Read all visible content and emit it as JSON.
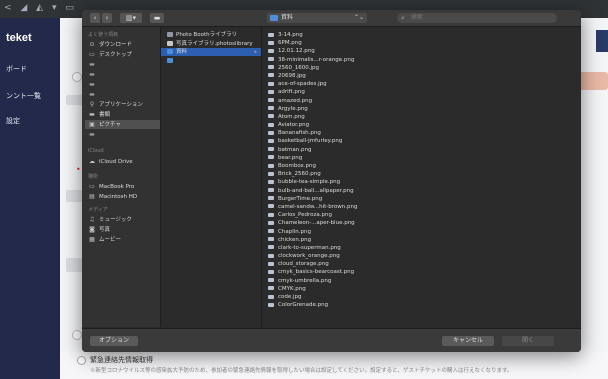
{
  "app": {
    "brand": "teket",
    "nav": [
      "ボード",
      "ンント一覧",
      "設定"
    ]
  },
  "background": {
    "emergency_title": "緊急連絡先情報取得",
    "emergency_desc": "※新型コロナウイルス等の感染拡大予防のため、参加者の緊急連絡先情報を取得したい場合は設定してください。設定すると、ゲストチケットの購入は行えなくなります。"
  },
  "dialog": {
    "toolbar": {
      "back": "‹",
      "forward": "›",
      "view": "▥▾",
      "path": "資料",
      "search_placeholder": "検索"
    },
    "sidebar": {
      "favorites_header": "よく使う項目",
      "favorites": [
        {
          "icon": "download-icon",
          "label": "ダウンロード"
        },
        {
          "icon": "desktop-icon",
          "label": "デスクトップ"
        },
        {
          "icon": "folder-icon",
          "label": ""
        },
        {
          "icon": "folder-icon",
          "label": ""
        },
        {
          "icon": "folder-icon",
          "label": ""
        },
        {
          "icon": "folder-icon",
          "label": ""
        },
        {
          "icon": "applications-icon",
          "label": "アプリケーション"
        },
        {
          "icon": "folder-icon",
          "label": "書類"
        },
        {
          "icon": "pictures-icon",
          "label": "ピクチャ"
        },
        {
          "icon": "folder-icon",
          "label": ""
        }
      ],
      "icloud_header": "iCloud",
      "icloud": [
        {
          "icon": "cloud-icon",
          "label": "iCloud Drive"
        }
      ],
      "locations_header": "場所",
      "locations": [
        {
          "icon": "laptop-icon",
          "label": "MacBook Pro"
        },
        {
          "icon": "disk-icon",
          "label": "Macintosh HD"
        }
      ],
      "media_header": "メディア",
      "media": [
        {
          "icon": "music-icon",
          "label": "ミュージック"
        },
        {
          "icon": "camera-icon",
          "label": "写真"
        },
        {
          "icon": "movie-icon",
          "label": "ムービー"
        }
      ]
    },
    "column1": [
      {
        "label": "Photo Boothライブラリ",
        "color": "#8e96a8",
        "selected": false,
        "chevron": false
      },
      {
        "label": "写真ライブラリ.photoslibrary",
        "color": "#c7c7c7",
        "selected": false,
        "chevron": false
      },
      {
        "label": "資料",
        "color": "#4e8ed8",
        "selected": true,
        "chevron": true
      },
      {
        "label": "",
        "color": "#4e8ed8",
        "selected": false,
        "chevron": false
      }
    ],
    "files": [
      "3-14.png",
      "6PM.png",
      "12.01.12.png",
      "38-minimalis...r-orange.png",
      "2560_1600.jpg",
      "20698.jpg",
      "ace-of-spades.jpg",
      "adrift.png",
      "amazed.png",
      "Argyle.png",
      "Atom.png",
      "Aviator.png",
      "Bananafish.png",
      "basketball-jmfurley.png",
      "batman.png",
      "bear.png",
      "Boombox.png",
      "Brick_2560.png",
      "bubble-tea-simple.png",
      "bulb-and-ball...allpaper.png",
      "BurgerTime.png",
      "camel-sandw...hit-brown.png",
      "Carlos_Pedroza.png",
      "Chameleon-...aper-blue.png",
      "Chaplin.png",
      "chicken.png",
      "clark-to-superman.png",
      "clockwork_orange.png",
      "cloud_storage.png",
      "cmyk_basics-bearcoast.png",
      "cmyk-umbrella.png",
      "CMYK.png",
      "code.jpg",
      "ColorGrenade.png"
    ],
    "bottom": {
      "options": "オプション",
      "cancel": "キャンセル",
      "open": "開く"
    }
  }
}
